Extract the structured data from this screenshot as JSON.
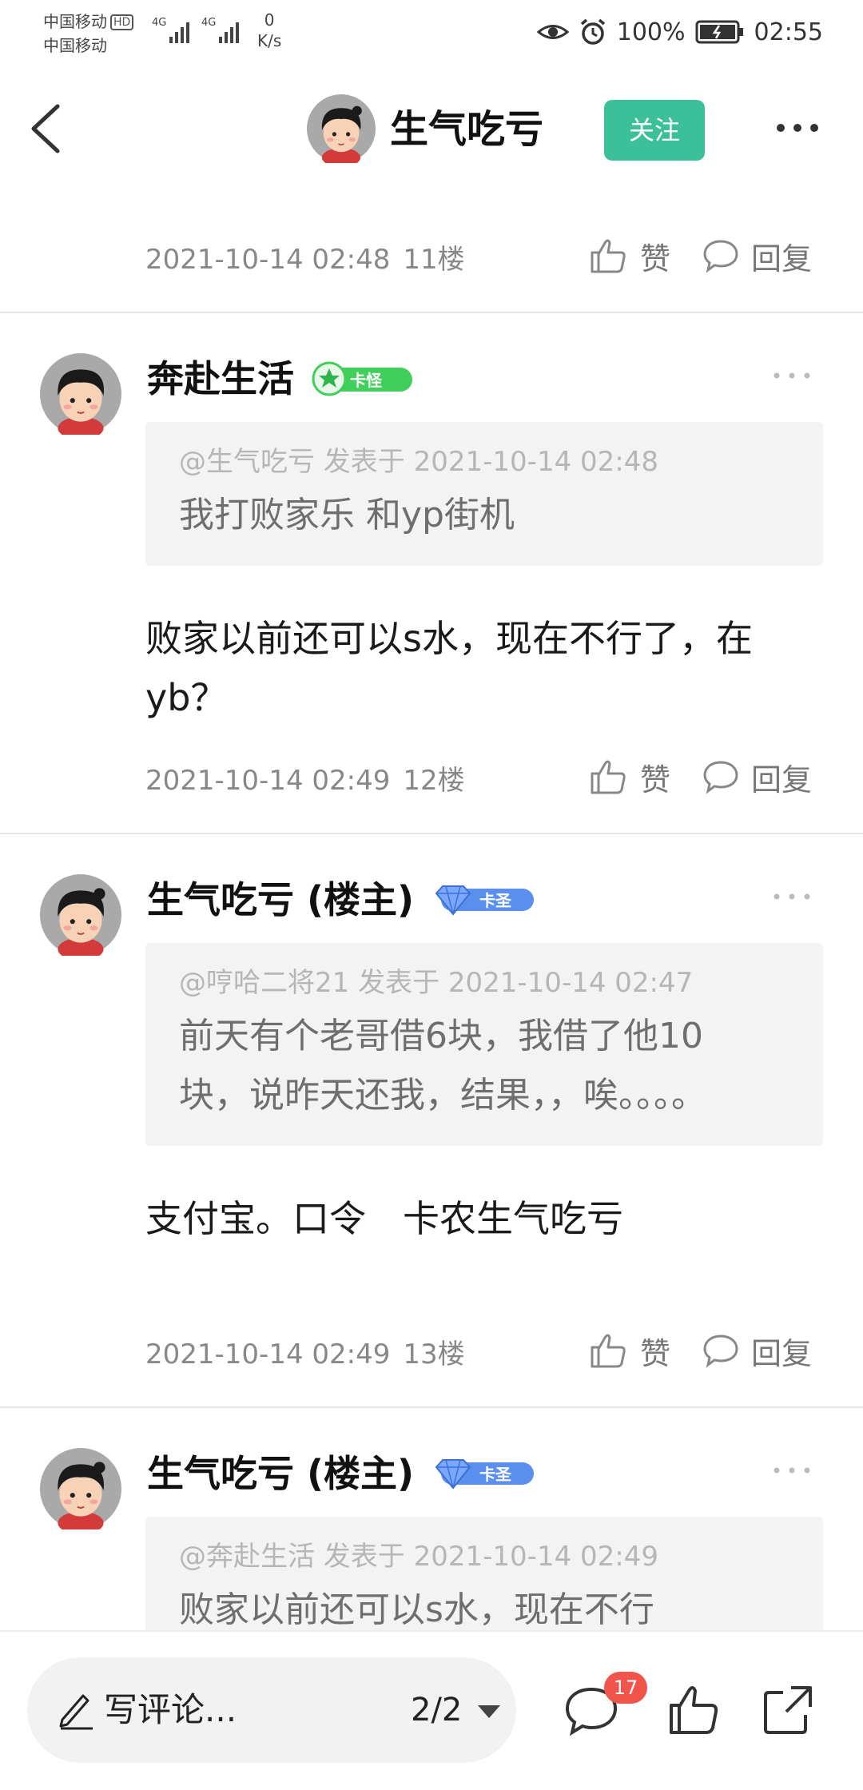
{
  "status_bar": {
    "carrier1": "中国移动",
    "hd": "HD",
    "carrier2": "中国移动",
    "net1": "4G",
    "net2": "4G",
    "speed_value": "0",
    "speed_unit": "K/s",
    "battery": "100%",
    "time": "02:55"
  },
  "header": {
    "title": "生气吃亏",
    "follow_label": "关注"
  },
  "actions": {
    "like_label": "赞",
    "reply_label": "回复"
  },
  "colors": {
    "accent": "#3cc09a",
    "badge_red": "#f0544b",
    "badge_green": "#3fcf5a",
    "badge_blue": "#5a8ff0"
  },
  "top_partial": {
    "date": "2021-10-14 02:48",
    "floor": "11楼"
  },
  "posts": [
    {
      "username": "奔赴生活",
      "badge": "卡怪",
      "quote_head": "@生气吃亏 发表于 2021-10-14 02:48",
      "quote_body": "我打败家乐 和yp街机",
      "text": "败家以前还可以s水，现在不行了，在yb？",
      "date": "2021-10-14 02:49",
      "floor": "12楼"
    },
    {
      "username": "生气吃亏 (楼主)",
      "badge": "卡圣",
      "quote_head": "@哼哈二将21 发表于 2021-10-14 02:47",
      "quote_body": "前天有个老哥借6块，我借了他10块，说昨天还我，结果，，唉。。。。",
      "text": "支付宝。口令　卡农生气吃亏",
      "date": "2021-10-14 02:49",
      "floor": "13楼"
    },
    {
      "username": "生气吃亏 (楼主)",
      "badge": "卡圣",
      "quote_head": "@奔赴生活 发表于 2021-10-14 02:49",
      "quote_body": "败家以前还可以s水，现在不行"
    }
  ],
  "bottom_bar": {
    "comment_placeholder": "写评论...",
    "page": "2/2",
    "comment_count": "17"
  }
}
